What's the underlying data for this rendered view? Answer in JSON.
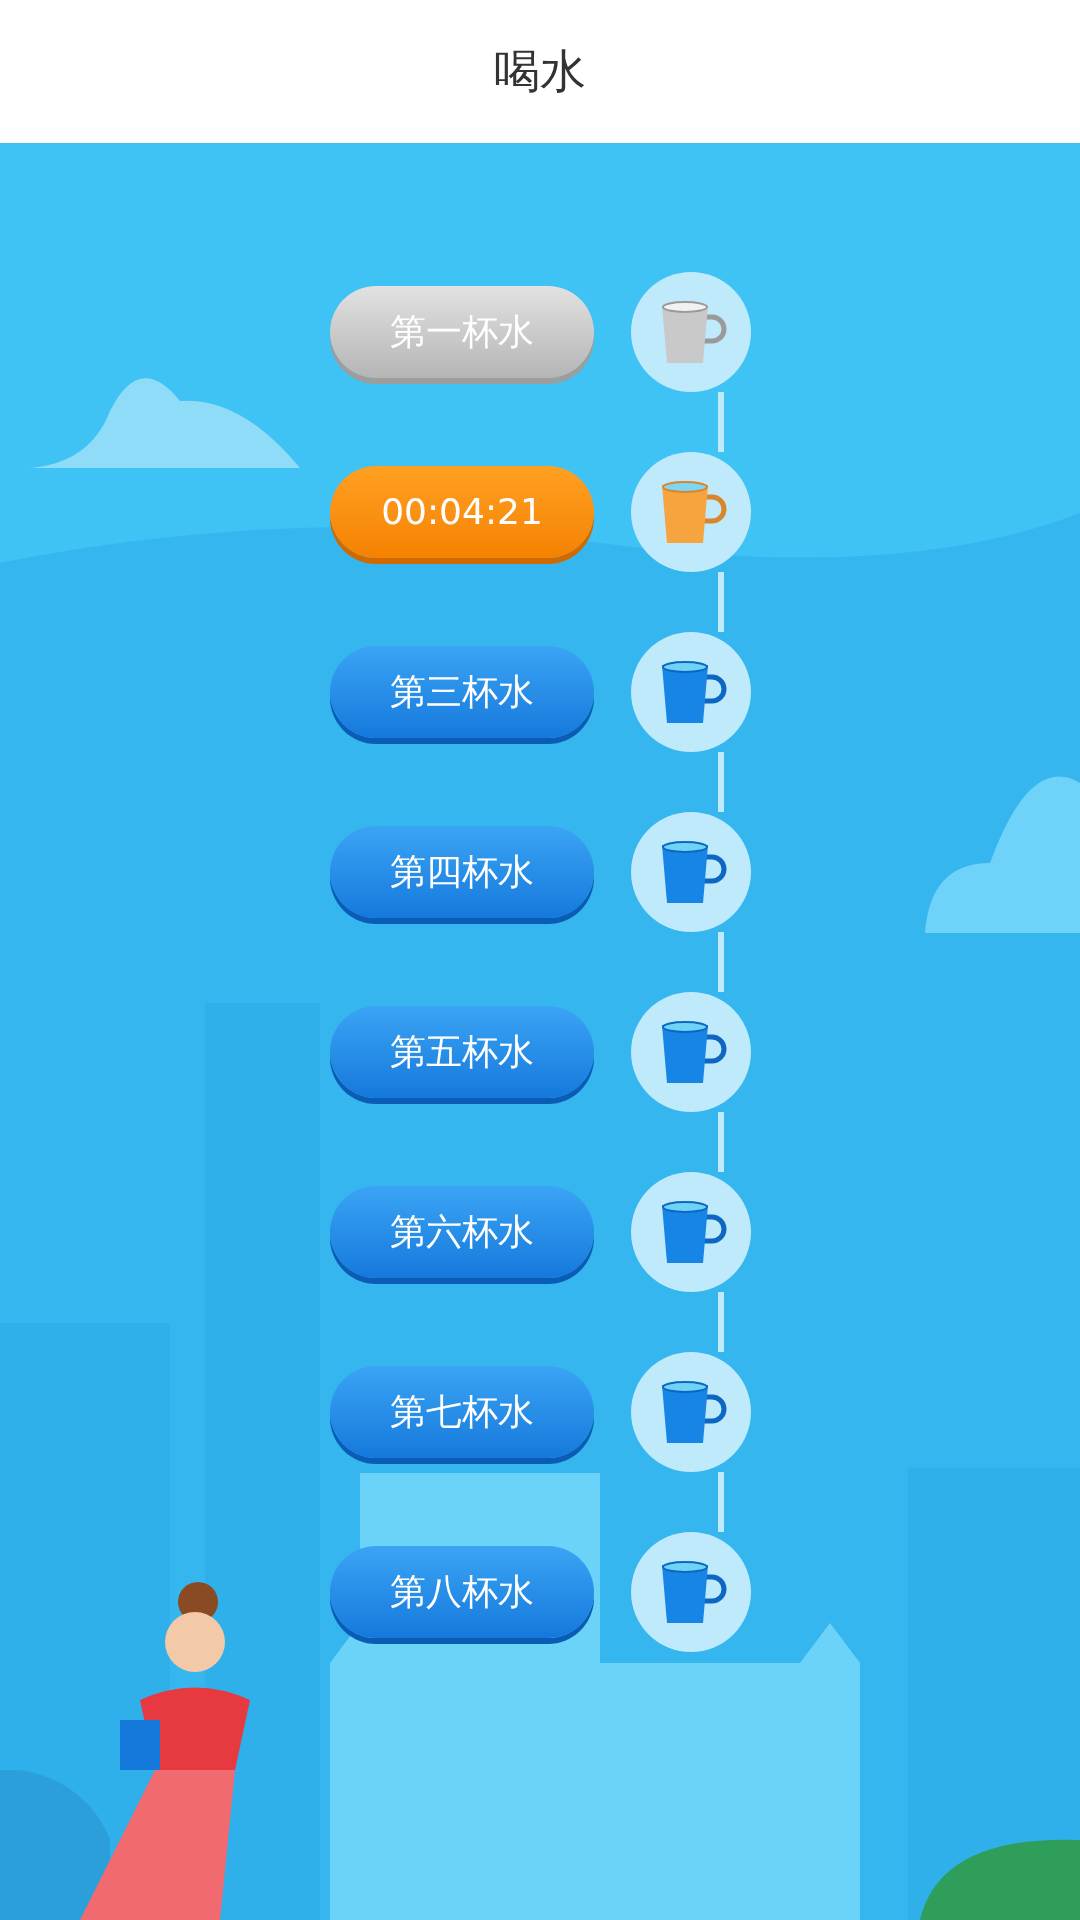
{
  "title": "喝水",
  "cups": [
    {
      "label": "第一杯水",
      "kind": "done"
    },
    {
      "label": "00:04:21",
      "kind": "current"
    },
    {
      "label": "第三杯水",
      "kind": "pending"
    },
    {
      "label": "第四杯水",
      "kind": "pending"
    },
    {
      "label": "第五杯水",
      "kind": "pending"
    },
    {
      "label": "第六杯水",
      "kind": "pending"
    },
    {
      "label": "第七杯水",
      "kind": "pending"
    },
    {
      "label": "第八杯水",
      "kind": "pending"
    }
  ]
}
